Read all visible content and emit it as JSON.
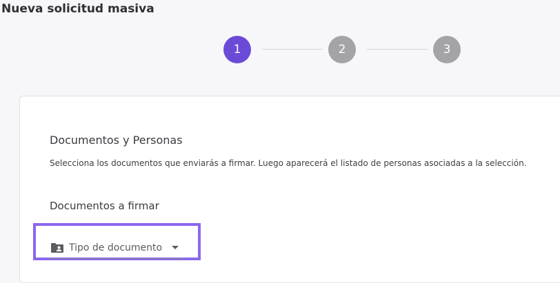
{
  "header": {
    "title": "Nueva solicitud masiva"
  },
  "stepper": {
    "steps": [
      {
        "label": "1",
        "state": "active"
      },
      {
        "label": "2",
        "state": "inactive"
      },
      {
        "label": "3",
        "state": "inactive"
      }
    ],
    "active_color": "#6b4ad8",
    "inactive_color": "#a3a3a8"
  },
  "card": {
    "title": "Documentos y Personas",
    "description": "Selecciona los documentos que enviarás a firmar. Luego aparecerá el listado de personas asociadas a la selección.",
    "documents_section_title": "Documentos a firmar",
    "document_type_select": {
      "label": "Tipo de documento",
      "icon": "folder-account-icon",
      "caret_icon": "caret-down-icon"
    }
  },
  "highlight_color": "#8b67ef"
}
